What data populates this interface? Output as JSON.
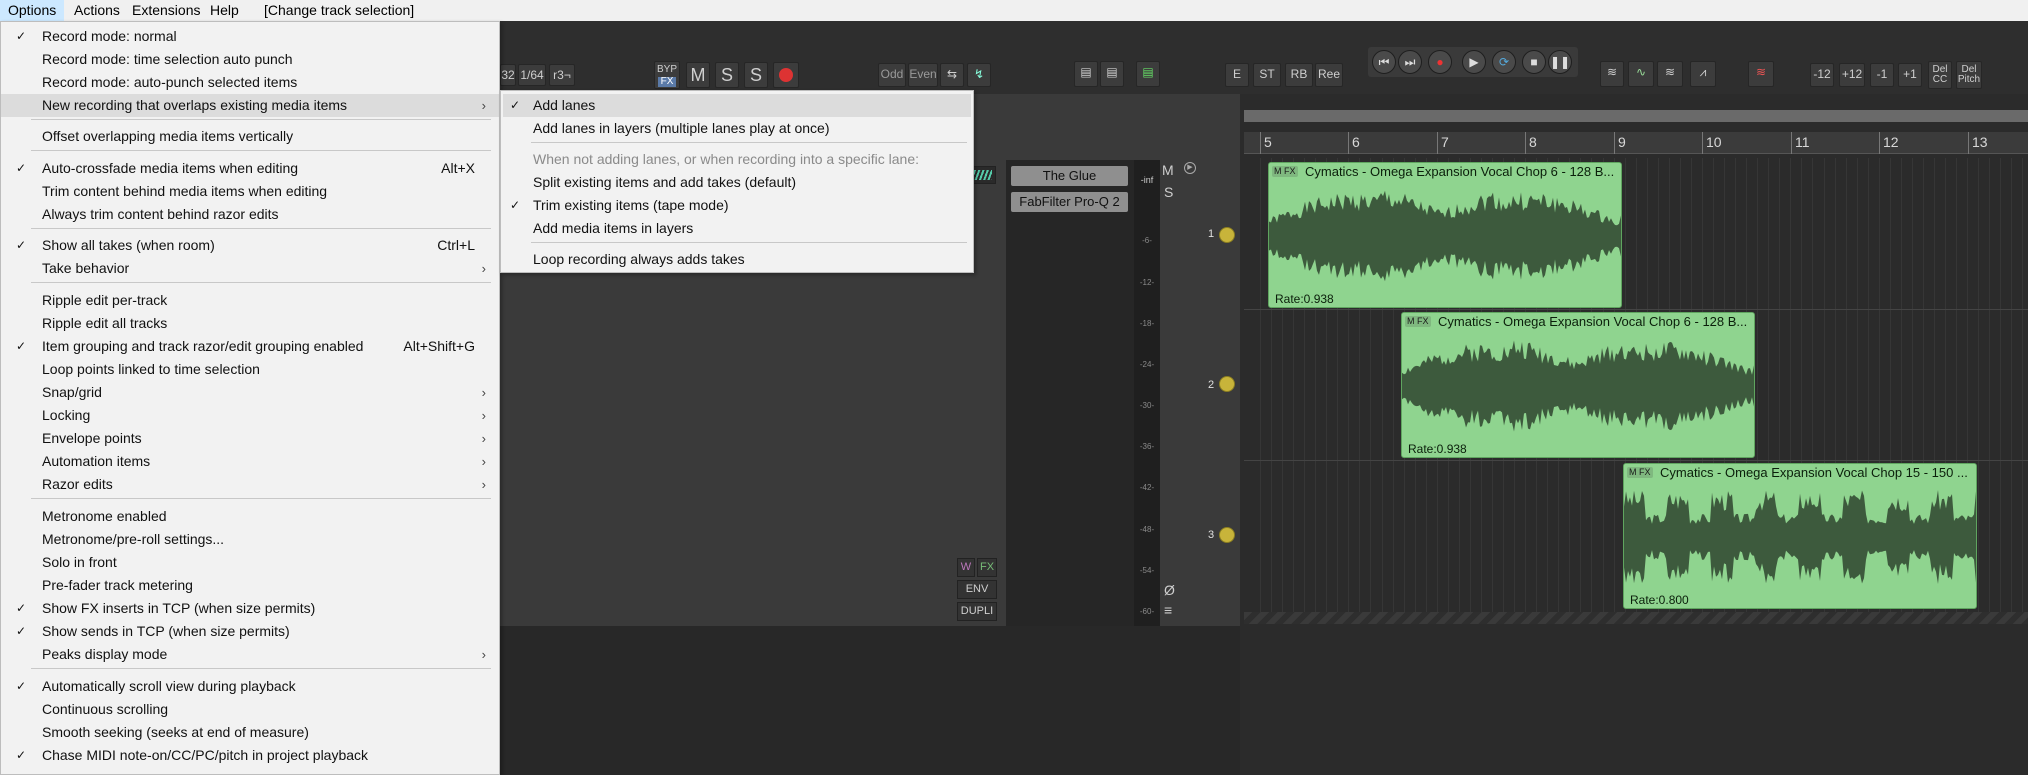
{
  "menubar": {
    "items": [
      "Options",
      "Actions",
      "Extensions",
      "Help",
      "[Change track selection]"
    ]
  },
  "toolbar": {
    "grid_values": [
      "32",
      "1/64",
      "r3¬"
    ],
    "byp_label": "BYP",
    "fx_label": "FX",
    "m_label": "M",
    "s_label": "S",
    "s2_label": "S",
    "odd_label": "Odd",
    "even_label": "Even",
    "e_label": "E",
    "st_label": "ST",
    "rb_label": "RB",
    "ree_label": "Ree",
    "pitch_buttons": [
      "-12",
      "+12",
      "-1",
      "+1"
    ],
    "del_cc_label": "Del CC",
    "del_pitch_label": "Del Pitch",
    "transport_icons": [
      "skip-back-icon",
      "skip-forward-icon",
      "record-icon",
      "play-icon",
      "loop-icon",
      "stop-icon",
      "pause-icon"
    ]
  },
  "options_menu": {
    "items": [
      {
        "label": "Record mode: normal",
        "checked": true
      },
      {
        "label": "Record mode: time selection auto punch"
      },
      {
        "label": "Record mode: auto-punch selected items"
      },
      {
        "label": "New recording that overlaps existing media items",
        "submenu": true,
        "highlighted": true
      },
      {
        "label": "Offset overlapping media items vertically"
      },
      {
        "label": "Auto-crossfade media items when editing",
        "checked": true,
        "shortcut": "Alt+X"
      },
      {
        "label": "Trim content behind media items when editing"
      },
      {
        "label": "Always trim content behind razor edits"
      },
      {
        "label": "Show all takes (when room)",
        "checked": true,
        "shortcut": "Ctrl+L"
      },
      {
        "label": "Take behavior",
        "submenu": true
      },
      {
        "label": "Ripple edit per-track"
      },
      {
        "label": "Ripple edit all tracks"
      },
      {
        "label": "Item grouping and track razor/edit grouping enabled",
        "checked": true,
        "shortcut": "Alt+Shift+G"
      },
      {
        "label": "Loop points linked to time selection"
      },
      {
        "label": "Snap/grid",
        "submenu": true
      },
      {
        "label": "Locking",
        "submenu": true
      },
      {
        "label": "Envelope points",
        "submenu": true
      },
      {
        "label": "Automation items",
        "submenu": true
      },
      {
        "label": "Razor edits",
        "submenu": true
      },
      {
        "label": "Metronome enabled"
      },
      {
        "label": "Metronome/pre-roll settings..."
      },
      {
        "label": "Solo in front"
      },
      {
        "label": "Pre-fader track metering"
      },
      {
        "label": "Show FX inserts in TCP (when size permits)",
        "checked": true
      },
      {
        "label": "Show sends in TCP (when size permits)",
        "checked": true
      },
      {
        "label": "Peaks display mode",
        "submenu": true
      },
      {
        "label": "Automatically scroll view during playback",
        "checked": true
      },
      {
        "label": "Continuous scrolling"
      },
      {
        "label": "Smooth seeking (seeks at end of measure)"
      },
      {
        "label": "Chase MIDI note-on/CC/PC/pitch in project playback",
        "checked": true
      }
    ]
  },
  "sub_menu": {
    "items": [
      {
        "label": "Add lanes",
        "checked": true,
        "highlighted": true
      },
      {
        "label": "Add lanes in layers (multiple lanes play at once)"
      },
      {
        "label": "When not adding lanes, or when recording into a specific lane:",
        "disabled": true
      },
      {
        "label": "Split existing items and add takes (default)"
      },
      {
        "label": "Trim existing items (tape mode)",
        "checked": true
      },
      {
        "label": "Add media items in layers"
      },
      {
        "label": "Loop recording always adds takes"
      }
    ]
  },
  "track_panel": {
    "fx_items": [
      "The Glue",
      "FabFilter Pro-Q 2"
    ],
    "meter_labels": [
      "-inf",
      "-6-",
      "-12-",
      "-18-",
      "-24-",
      "-30-",
      "-36-",
      "-42-",
      "-48-",
      "-54-",
      "-60-"
    ],
    "m_label": "M",
    "s_label": "S",
    "phase_symbol": "Ø",
    "menu_symbol": "≡",
    "track_numbers": [
      "1",
      "2",
      "3"
    ],
    "w_label": "W",
    "fx_label": "FX",
    "env_label": "ENV",
    "dupli_label": "DUPLI"
  },
  "ruler": {
    "marks": [
      "5",
      "6",
      "7",
      "8",
      "9",
      "10",
      "11",
      "12",
      "13"
    ]
  },
  "clips": [
    {
      "title": "Cymatics - Omega Expansion Vocal Chop 6 - 128 B...",
      "rate": "Rate:0.938",
      "m": "M",
      "fx": "FX"
    },
    {
      "title": "Cymatics - Omega Expansion Vocal Chop 6 - 128 B...",
      "rate": "Rate:0.938",
      "m": "M",
      "fx": "FX"
    },
    {
      "title": "Cymatics - Omega Expansion Vocal Chop 15 - 150 ...",
      "rate": "Rate:0.800",
      "m": "M",
      "fx": "FX"
    }
  ],
  "colors": {
    "clip_fill": "#8fd48f",
    "waveform": "#3d5a3d",
    "knob": "#c8b43a",
    "menu_bg": "#f2f2f2"
  }
}
